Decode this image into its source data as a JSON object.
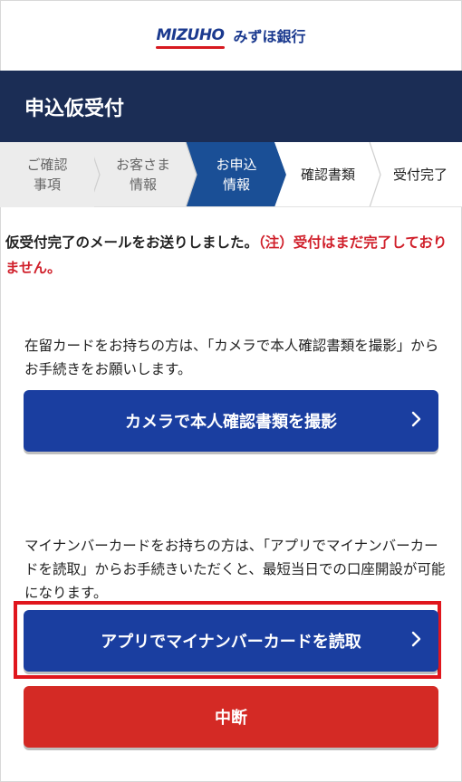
{
  "brand": {
    "logo_mark": "MIZUHO",
    "bank_name": "みずほ銀行"
  },
  "header": {
    "title": "申込仮受付"
  },
  "steps": [
    {
      "label_line1": "ご確認",
      "label_line2": "事項",
      "state": "done"
    },
    {
      "label_line1": "お客さま",
      "label_line2": "情報",
      "state": "done"
    },
    {
      "label_line1": "お申込",
      "label_line2": "情報",
      "state": "current"
    },
    {
      "label_line1": "確認書類",
      "label_line2": "",
      "state": "todo"
    },
    {
      "label_line1": "受付完了",
      "label_line2": "",
      "state": "todo"
    }
  ],
  "message": {
    "main": "仮受付完了のメールをお送りしました。",
    "warning": "（注）受付はまだ完了しておりません。"
  },
  "camera_section": {
    "description": "在留カードをお持ちの方は、「カメラで本人確認書類を撮影」からお手続きをお願いします。",
    "button_label": "カメラで本人確認書類を撮影"
  },
  "app_section": {
    "description": "マイナンバーカードをお持ちの方は、「アプリでマイナンバーカードを読取」からお手続きいただくと、最短当日での口座開設が可能になります。",
    "button_label": "アプリでマイナンバーカードを読取"
  },
  "cancel_button": {
    "label": "中断"
  },
  "arrow_glyph": "〉",
  "colors": {
    "brand_navy": "#1b2d55",
    "current_step": "#1a4f96",
    "primary_button": "#1a3ea0",
    "danger_button": "#d42a25",
    "warning_text": "#d01f2a",
    "highlight_border": "#e0161d"
  }
}
